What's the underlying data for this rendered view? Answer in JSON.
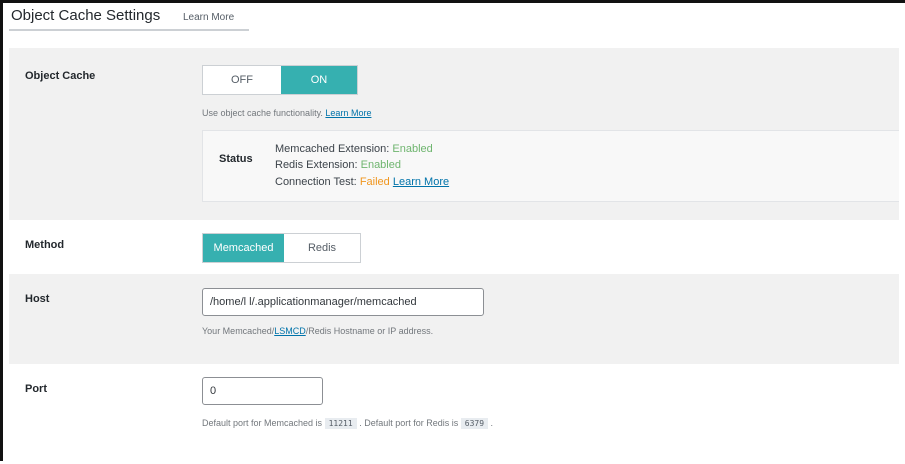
{
  "header": {
    "title": "Object Cache Settings",
    "learn_more": "Learn More"
  },
  "object_cache": {
    "label": "Object Cache",
    "toggle": {
      "off": "OFF",
      "on": "ON",
      "selected": "ON"
    },
    "help_text": "Use object cache functionality.",
    "help_link": "Learn More",
    "status": {
      "label": "Status",
      "memcached_label": "Memcached Extension:",
      "memcached_value": "Enabled",
      "redis_label": "Redis Extension:",
      "redis_value": "Enabled",
      "connection_label": "Connection Test:",
      "connection_value": "Failed",
      "connection_link": "Learn More"
    }
  },
  "method": {
    "label": "Method",
    "options": [
      "Memcached",
      "Redis"
    ],
    "selected": "Memcached"
  },
  "host": {
    "label": "Host",
    "value": "/home/l              l/.applicationmanager/memcached",
    "help_prefix": "Your Memcached/",
    "help_link": "LSMCD",
    "help_suffix": "/Redis Hostname or IP address."
  },
  "port": {
    "label": "Port",
    "value": "0",
    "help_part1": "Default port for Memcached is",
    "memcached_port": "11211",
    "help_part2": ". Default port for Redis is",
    "redis_port": "6379",
    "help_part3": "."
  },
  "colors": {
    "accent": "#36b0b0",
    "enabled": "#6fb56f",
    "failed": "#f0961e",
    "link": "#0073aa"
  }
}
